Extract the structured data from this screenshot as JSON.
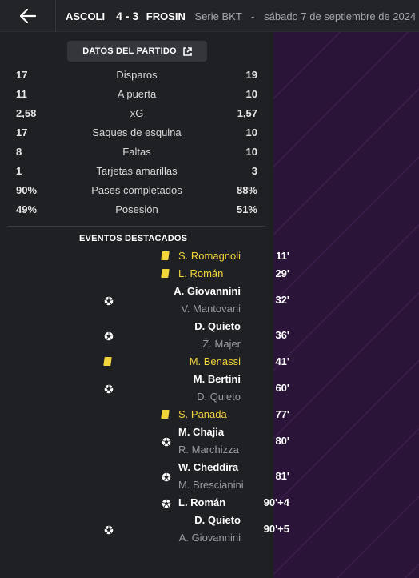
{
  "header": {
    "home_team": "ASCOLI",
    "score": "4 - 3",
    "away_team": "FROSIN",
    "competition": "Serie BKT",
    "separator": "-",
    "date": "sábado 7 de septiembre de 2024"
  },
  "stats": {
    "title": "DATOS DEL PARTIDO",
    "rows": [
      {
        "home": "17",
        "label": "Disparos",
        "away": "19"
      },
      {
        "home": "11",
        "label": "A puerta",
        "away": "10"
      },
      {
        "home": "2,58",
        "label": "xG",
        "away": "1,57"
      },
      {
        "home": "17",
        "label": "Saques de esquina",
        "away": "10"
      },
      {
        "home": "8",
        "label": "Faltas",
        "away": "10"
      },
      {
        "home": "1",
        "label": "Tarjetas amarillas",
        "away": "3"
      },
      {
        "home": "90%",
        "label": "Pases completados",
        "away": "88%"
      },
      {
        "home": "49%",
        "label": "Posesión",
        "away": "51%"
      }
    ]
  },
  "events": {
    "title": "EVENTOS DESTACADOS",
    "items": [
      {
        "minute": "11'",
        "side": "away",
        "type": "yellow-card",
        "player": "S. Romagnoli"
      },
      {
        "minute": "29'",
        "side": "away",
        "type": "yellow-card",
        "player": "L. Román"
      },
      {
        "minute": "32'",
        "side": "home",
        "type": "goal",
        "player": "A. Giovannini",
        "assist": "V. Mantovani"
      },
      {
        "minute": "36'",
        "side": "home",
        "type": "goal",
        "player": "D. Quieto",
        "assist": "Ž. Majer"
      },
      {
        "minute": "41'",
        "side": "home",
        "type": "yellow-card",
        "player": "M. Benassi"
      },
      {
        "minute": "60'",
        "side": "home",
        "type": "goal",
        "player": "M. Bertini",
        "assist": "D. Quieto"
      },
      {
        "minute": "77'",
        "side": "away",
        "type": "yellow-card",
        "player": "S. Panada"
      },
      {
        "minute": "80'",
        "side": "away",
        "type": "goal",
        "player": "M. Chajia",
        "assist": "R. Marchizza"
      },
      {
        "minute": "81'",
        "side": "away",
        "type": "goal",
        "player": "W. Cheddira",
        "assist": "M. Brescianini"
      },
      {
        "minute": "90'+4",
        "side": "away",
        "type": "goal",
        "player": "L. Román"
      },
      {
        "minute": "90'+5",
        "side": "home",
        "type": "goal",
        "player": "D. Quieto",
        "assist": "A. Giovannini"
      }
    ]
  },
  "colors": {
    "card_yellow": "#f2d43b",
    "panel_bg": "#1f2023",
    "accent_purple": "#2a1438"
  },
  "icons": {
    "back": "arrow-left-icon",
    "external": "external-link-icon",
    "goal": "football-icon",
    "card": "yellow-card-icon"
  }
}
